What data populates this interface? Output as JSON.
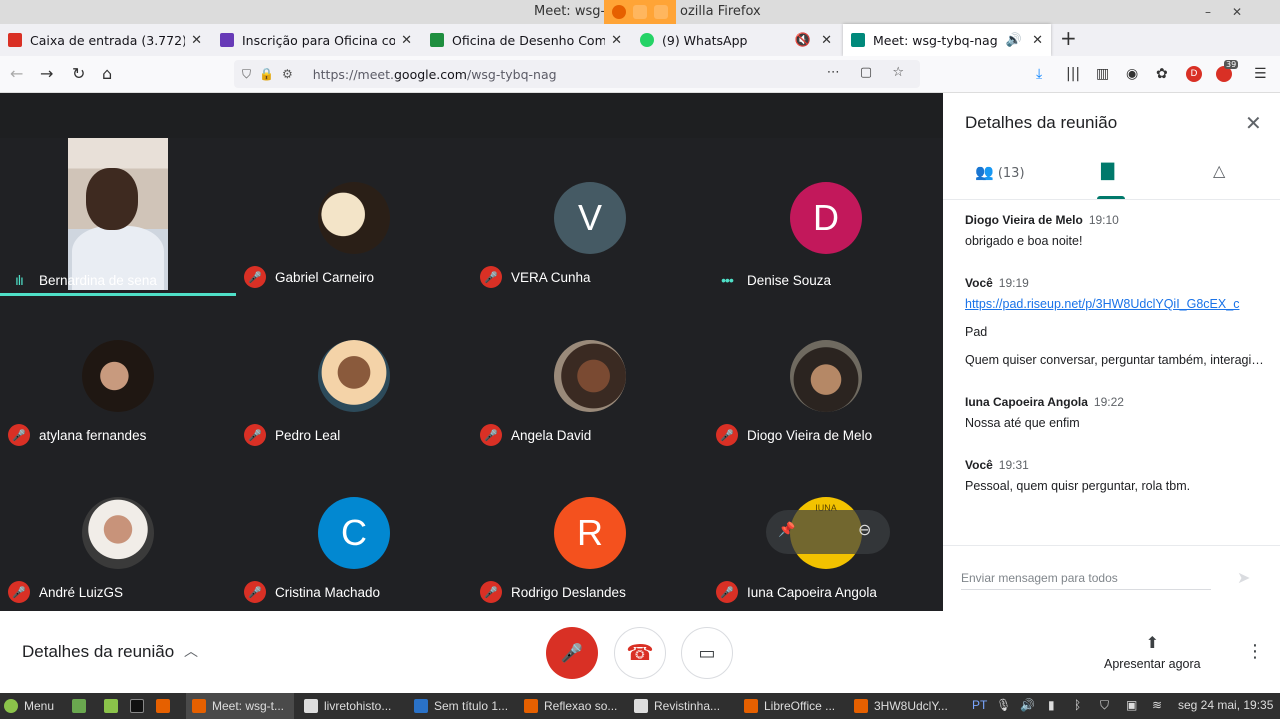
{
  "window": {
    "title": "Meet: wsg-tybq-nag — Mozilla Firefox",
    "title_visible_left": "Meet: wsg-t",
    "title_visible_right": "ozilla Firefox",
    "controls": [
      "–",
      "✕"
    ]
  },
  "tabs": [
    {
      "label": "Caixa de entrada (3.772) - d",
      "color": "#d93025",
      "icon": "gmail-icon"
    },
    {
      "label": "Inscrição para Oficina comu",
      "color": "#673ab7",
      "icon": "forms-icon"
    },
    {
      "label": "Oficina de Desenho Comun",
      "color": "#1e8e3e",
      "icon": "drive-icon"
    },
    {
      "label": "(9) WhatsApp",
      "color": "#25d366",
      "icon": "whatsapp-icon"
    },
    {
      "label": "Meet: wsg-tybq-nag",
      "color": "#00897b",
      "icon": "meet-icon"
    }
  ],
  "nav": {
    "url_prefix": "https://meet.",
    "url_domain": "google.com",
    "url_path": "/wsg-tybq-nag",
    "badge_count": "39",
    "profile_letter": "D"
  },
  "participants": [
    {
      "name": "Bernardina de sena",
      "type": "video",
      "status": "speaking"
    },
    {
      "name": "Gabriel Carneiro",
      "type": "photo",
      "status": "muted"
    },
    {
      "name": "VERA Cunha",
      "type": "letter",
      "letter": "V",
      "color": "#455a64",
      "status": "muted"
    },
    {
      "name": "Denise Souza",
      "type": "letter",
      "letter": "D",
      "color": "#c2185b",
      "status": "dots"
    },
    {
      "name": "atylana fernandes",
      "type": "photo",
      "status": "muted"
    },
    {
      "name": "Pedro Leal",
      "type": "photo",
      "status": "muted"
    },
    {
      "name": "Angela David",
      "type": "photo",
      "status": "muted"
    },
    {
      "name": "Diogo Vieira de Melo",
      "type": "photo",
      "status": "muted"
    },
    {
      "name": "André LuizGS",
      "type": "photo",
      "status": "muted"
    },
    {
      "name": "Cristina Machado",
      "type": "letter",
      "letter": "C",
      "color": "#0288d1",
      "status": "muted"
    },
    {
      "name": "Rodrigo Deslandes",
      "type": "letter",
      "letter": "R",
      "color": "#f4511e",
      "status": "muted"
    },
    {
      "name": "Iuna Capoeira Angola",
      "type": "logo",
      "logo_text": "IUNA",
      "color": "#f2c200",
      "status": "muted"
    }
  ],
  "panel": {
    "title": "Detalhes da reunião",
    "people_count": "(13)",
    "messages": [
      {
        "sender": "Diogo Vieira de Melo",
        "time": "19:10",
        "lines": [
          "obrigado e boa noite!"
        ]
      },
      {
        "sender": "Você",
        "time": "19:19",
        "lines": [
          "https://pad.riseup.net/p/3HW8UdclYQiI_G8cEX_c",
          "Pad",
          "Quem quiser conversar, perguntar também, interagir..."
        ]
      },
      {
        "sender": "Iuna Capoeira Angola",
        "time": "19:22",
        "lines": [
          "Nossa até que enfim"
        ]
      },
      {
        "sender": "Você",
        "time": "19:31",
        "lines": [
          "Pessoal, quem quisr perguntar, rola tbm."
        ]
      }
    ],
    "input_placeholder": "Enviar mensagem para todos"
  },
  "bottom": {
    "details_label": "Detalhes da reunião",
    "present_label": "Apresentar agora"
  },
  "taskbar": {
    "menu_label": "Menu",
    "windows": [
      "Meet: wsg-t...",
      "livretohisto...",
      "Sem título 1...",
      "Reflexao so...",
      "Revistinha...",
      "LibreOffice ...",
      "3HW8UdclY..."
    ],
    "lang": "PT",
    "clock": "seg 24 mai, 19:35"
  },
  "colors": {
    "meet_bg": "#202124",
    "mute_red": "#d93025",
    "speaking": "#4fe0c8",
    "accent": "#00796b"
  }
}
